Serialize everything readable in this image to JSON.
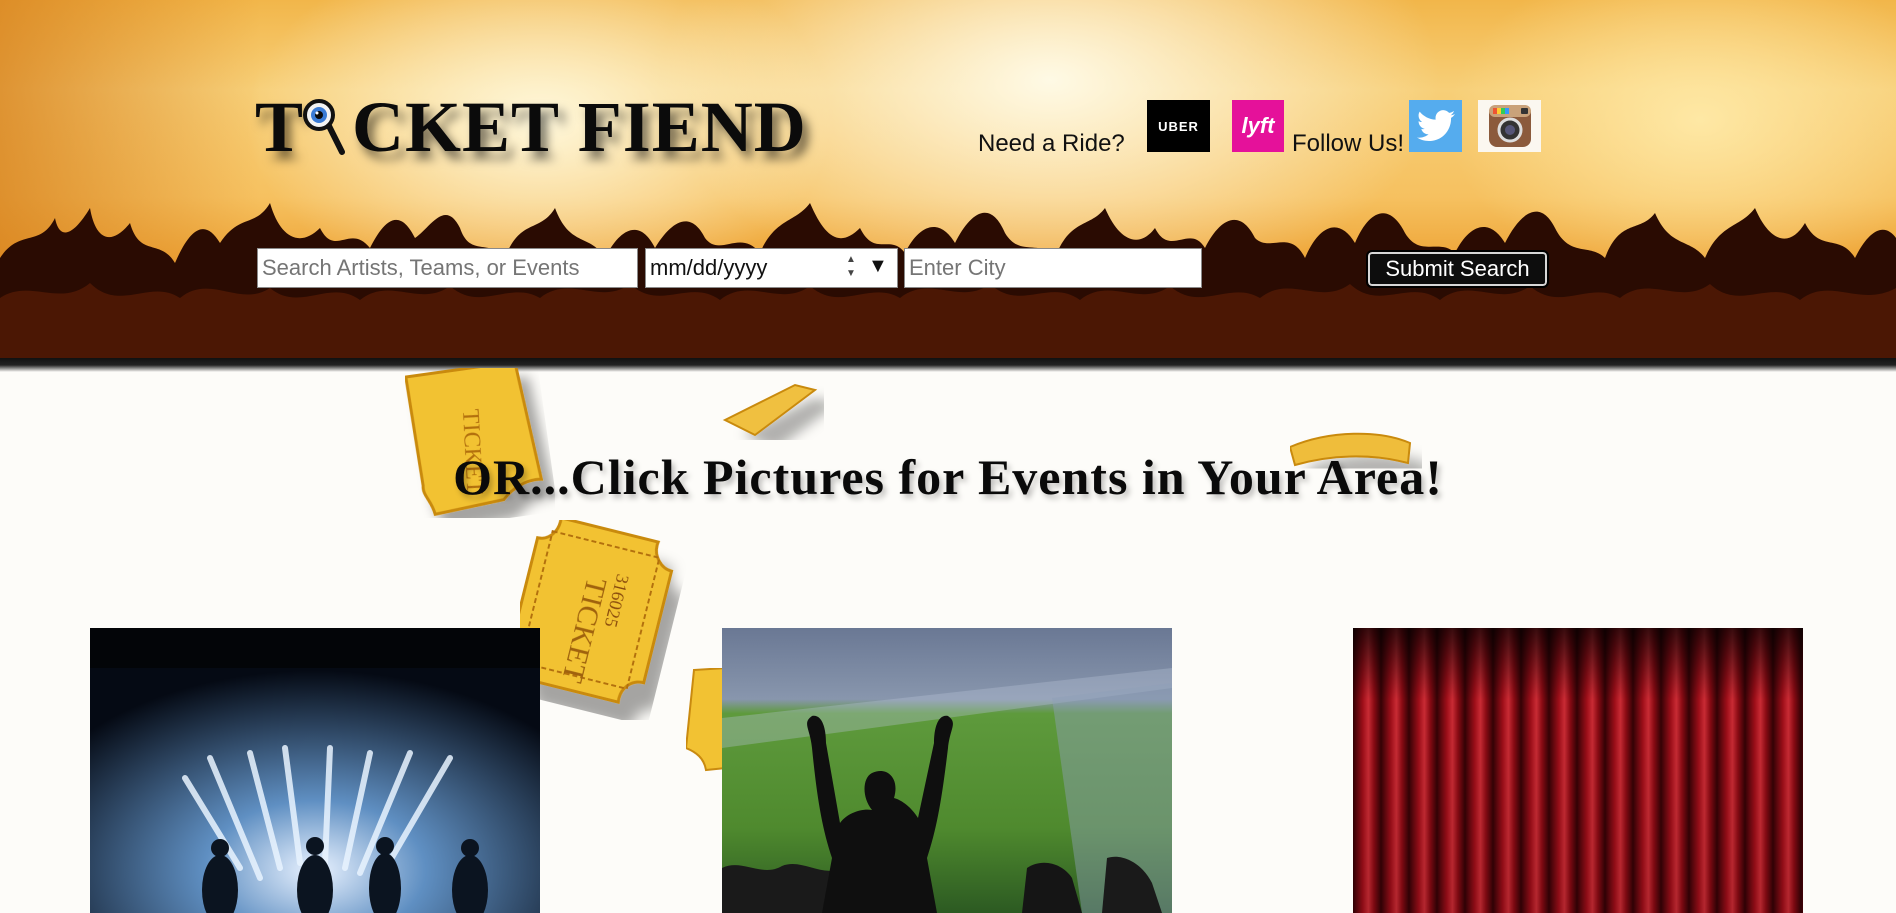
{
  "header": {
    "logo_text": "TICKET FIEND",
    "logo_prefix": "T",
    "logo_suffix": "CKET FIEND",
    "ride_label": "Need a Ride?",
    "follow_label": "Follow Us!",
    "ride_services": [
      {
        "name": "uber-logo",
        "text": "UBER"
      },
      {
        "name": "lyft-logo",
        "text": "lyft"
      }
    ],
    "social_icons": [
      "twitter-icon",
      "instagram-icon"
    ]
  },
  "search": {
    "query_placeholder": "Search Artists, Teams, or Events",
    "date_placeholder": "mm/dd/yyyy",
    "city_placeholder": "Enter City",
    "submit_label": "Submit Search"
  },
  "main": {
    "headline": "OR...Click Pictures for Events in Your Area!",
    "categories": [
      {
        "name": "concerts",
        "image": "concert-stage-image"
      },
      {
        "name": "sports",
        "image": "stadium-fan-image"
      },
      {
        "name": "theater",
        "image": "red-curtain-image"
      }
    ]
  },
  "decor": {
    "ticket_text": "TICKET",
    "ticket_number": "316025"
  },
  "colors": {
    "uber": "#000000",
    "lyft": "#e5119a",
    "twitter": "#55acee",
    "ticket_gold": "#f2c233",
    "curtain_red": "#b0101c"
  }
}
